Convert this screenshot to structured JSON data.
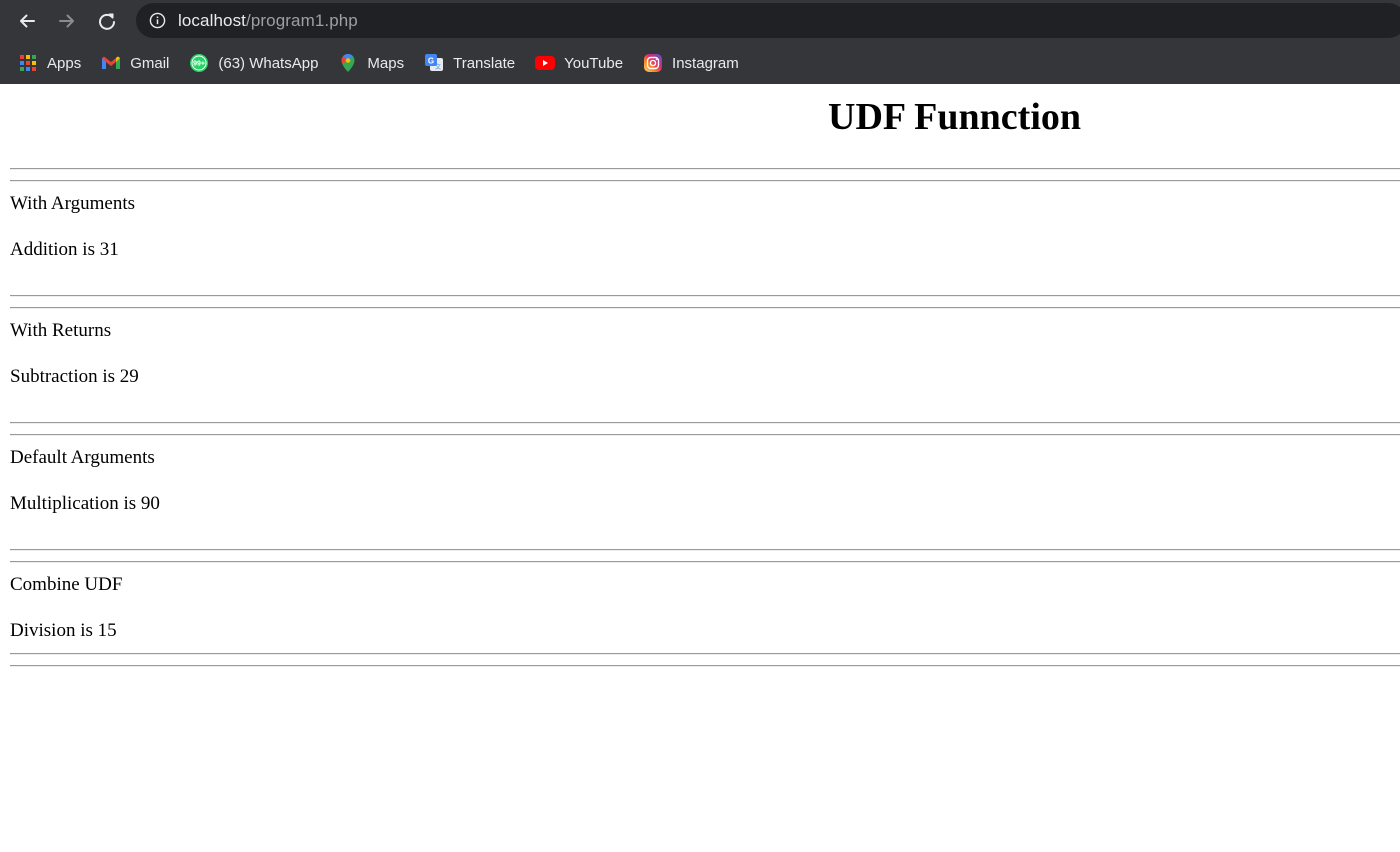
{
  "browser": {
    "url_host": "localhost",
    "url_path": "/program1.php",
    "bookmarks": [
      {
        "label": "Apps",
        "icon": "apps-grid-icon"
      },
      {
        "label": "Gmail",
        "icon": "gmail-icon"
      },
      {
        "label": "(63) WhatsApp",
        "icon": "whatsapp-icon",
        "badge": "99+"
      },
      {
        "label": "Maps",
        "icon": "maps-pin-icon"
      },
      {
        "label": "Translate",
        "icon": "translate-icon"
      },
      {
        "label": "YouTube",
        "icon": "youtube-icon"
      },
      {
        "label": "Instagram",
        "icon": "instagram-icon"
      }
    ]
  },
  "page": {
    "title": "UDF Funnction",
    "sections": [
      {
        "heading": "With Arguments",
        "result": "Addition is 31"
      },
      {
        "heading": "With Returns",
        "result": "Subtraction is 29"
      },
      {
        "heading": "Default Arguments",
        "result": "Multiplication is 90"
      },
      {
        "heading": "Combine UDF",
        "result": "Division is 15"
      }
    ]
  },
  "colors": {
    "chrome_bg": "#35363a",
    "omnibox_bg": "#202124",
    "chrome_text": "#e8eaed",
    "url_path": "#9aa0a6",
    "rule": "#9a9a9a"
  }
}
